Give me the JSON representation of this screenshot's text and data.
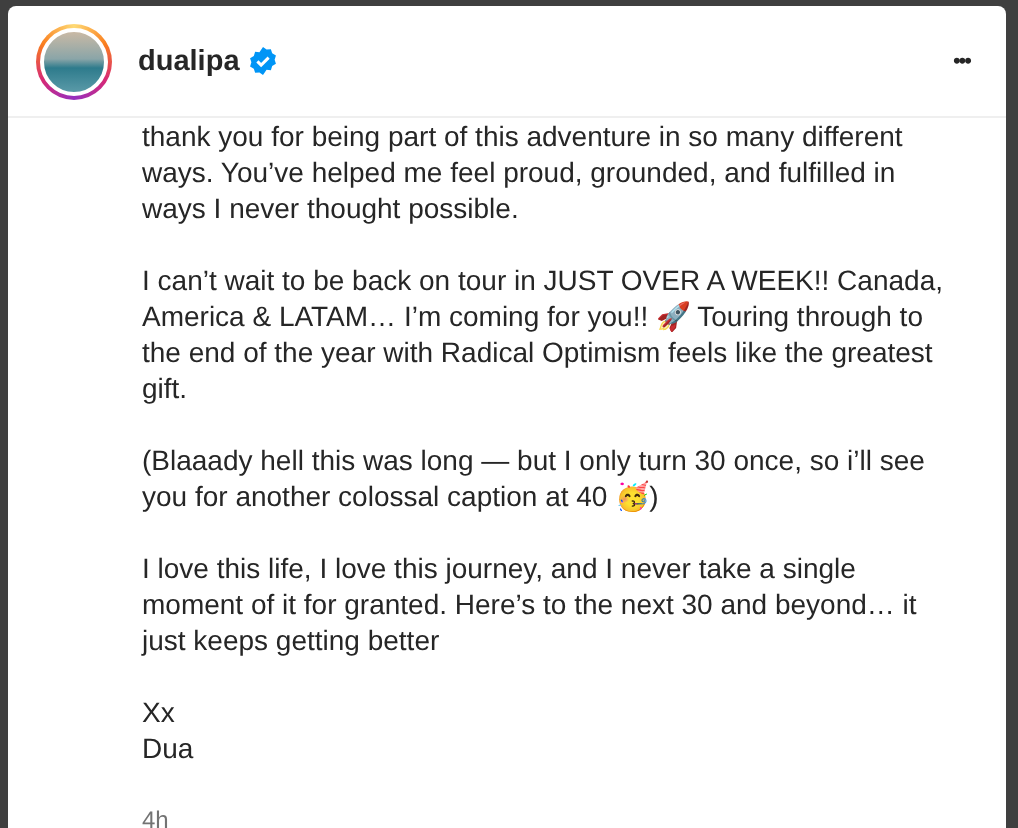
{
  "post": {
    "username": "dualipa",
    "more_label": "•••",
    "caption": [
      "thank you for being part of this adventure in so many different ways. You’ve helped me feel proud, grounded, and fulfilled in ways I never thought possible.",
      "I can’t wait to be back on tour in JUST OVER A WEEK!! Canada, America & LATAM… I’m coming for you!! 🚀 Touring through to the end of the year with Radical Optimism feels like the greatest gift.",
      "(Blaaady hell this was long — but I only turn 30 once, so i’ll see you for another colossal caption at 40 🥳)",
      "I love this life, I love this journey, and I never take a single moment of it for granted. Here’s to the next 30 and beyond… it just keeps getting better",
      "Xx\nDua"
    ],
    "time": "4h"
  }
}
